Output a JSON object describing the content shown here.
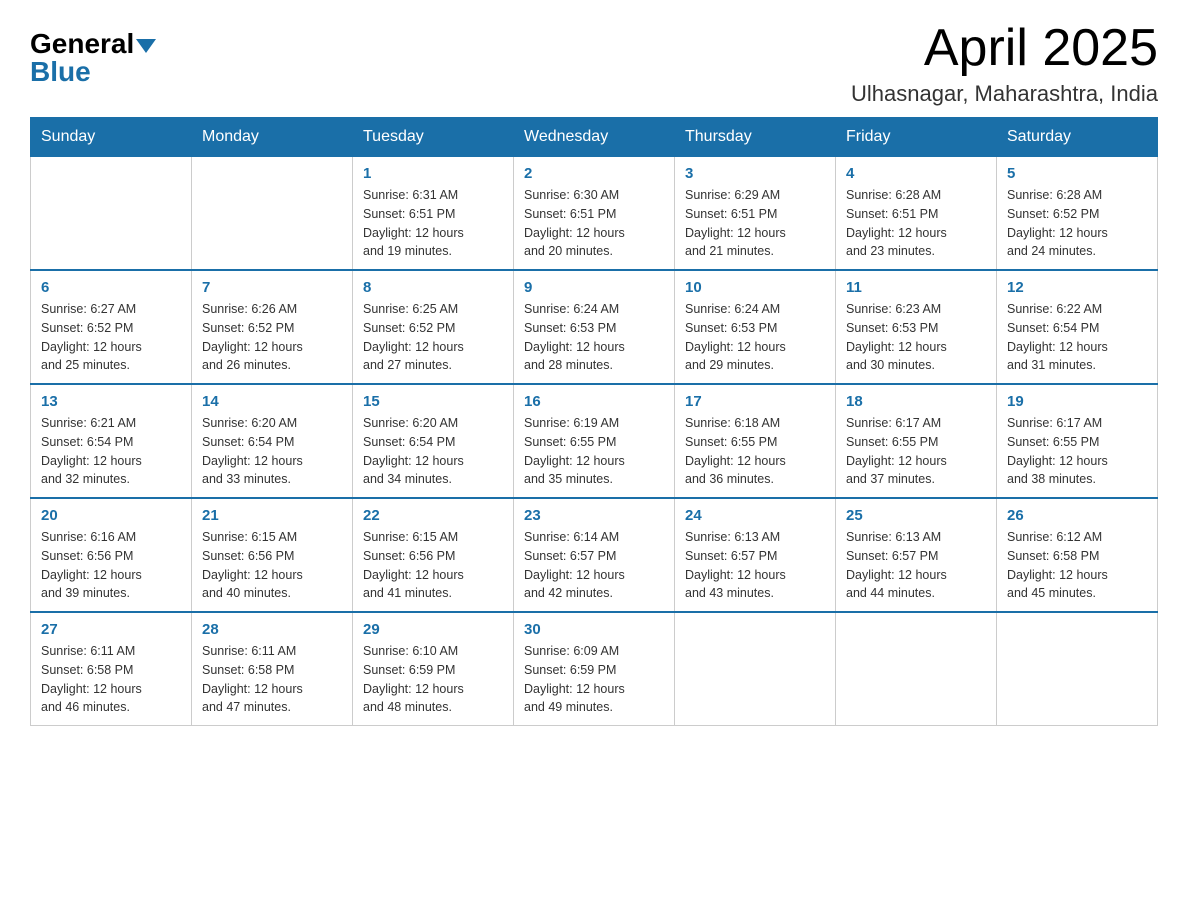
{
  "header": {
    "logo": {
      "general": "General",
      "blue": "Blue"
    },
    "title": "April 2025",
    "location": "Ulhasnagar, Maharashtra, India"
  },
  "weekdays": [
    "Sunday",
    "Monday",
    "Tuesday",
    "Wednesday",
    "Thursday",
    "Friday",
    "Saturday"
  ],
  "weeks": [
    [
      {
        "day": "",
        "info": ""
      },
      {
        "day": "",
        "info": ""
      },
      {
        "day": "1",
        "info": "Sunrise: 6:31 AM\nSunset: 6:51 PM\nDaylight: 12 hours\nand 19 minutes."
      },
      {
        "day": "2",
        "info": "Sunrise: 6:30 AM\nSunset: 6:51 PM\nDaylight: 12 hours\nand 20 minutes."
      },
      {
        "day": "3",
        "info": "Sunrise: 6:29 AM\nSunset: 6:51 PM\nDaylight: 12 hours\nand 21 minutes."
      },
      {
        "day": "4",
        "info": "Sunrise: 6:28 AM\nSunset: 6:51 PM\nDaylight: 12 hours\nand 23 minutes."
      },
      {
        "day": "5",
        "info": "Sunrise: 6:28 AM\nSunset: 6:52 PM\nDaylight: 12 hours\nand 24 minutes."
      }
    ],
    [
      {
        "day": "6",
        "info": "Sunrise: 6:27 AM\nSunset: 6:52 PM\nDaylight: 12 hours\nand 25 minutes."
      },
      {
        "day": "7",
        "info": "Sunrise: 6:26 AM\nSunset: 6:52 PM\nDaylight: 12 hours\nand 26 minutes."
      },
      {
        "day": "8",
        "info": "Sunrise: 6:25 AM\nSunset: 6:52 PM\nDaylight: 12 hours\nand 27 minutes."
      },
      {
        "day": "9",
        "info": "Sunrise: 6:24 AM\nSunset: 6:53 PM\nDaylight: 12 hours\nand 28 minutes."
      },
      {
        "day": "10",
        "info": "Sunrise: 6:24 AM\nSunset: 6:53 PM\nDaylight: 12 hours\nand 29 minutes."
      },
      {
        "day": "11",
        "info": "Sunrise: 6:23 AM\nSunset: 6:53 PM\nDaylight: 12 hours\nand 30 minutes."
      },
      {
        "day": "12",
        "info": "Sunrise: 6:22 AM\nSunset: 6:54 PM\nDaylight: 12 hours\nand 31 minutes."
      }
    ],
    [
      {
        "day": "13",
        "info": "Sunrise: 6:21 AM\nSunset: 6:54 PM\nDaylight: 12 hours\nand 32 minutes."
      },
      {
        "day": "14",
        "info": "Sunrise: 6:20 AM\nSunset: 6:54 PM\nDaylight: 12 hours\nand 33 minutes."
      },
      {
        "day": "15",
        "info": "Sunrise: 6:20 AM\nSunset: 6:54 PM\nDaylight: 12 hours\nand 34 minutes."
      },
      {
        "day": "16",
        "info": "Sunrise: 6:19 AM\nSunset: 6:55 PM\nDaylight: 12 hours\nand 35 minutes."
      },
      {
        "day": "17",
        "info": "Sunrise: 6:18 AM\nSunset: 6:55 PM\nDaylight: 12 hours\nand 36 minutes."
      },
      {
        "day": "18",
        "info": "Sunrise: 6:17 AM\nSunset: 6:55 PM\nDaylight: 12 hours\nand 37 minutes."
      },
      {
        "day": "19",
        "info": "Sunrise: 6:17 AM\nSunset: 6:55 PM\nDaylight: 12 hours\nand 38 minutes."
      }
    ],
    [
      {
        "day": "20",
        "info": "Sunrise: 6:16 AM\nSunset: 6:56 PM\nDaylight: 12 hours\nand 39 minutes."
      },
      {
        "day": "21",
        "info": "Sunrise: 6:15 AM\nSunset: 6:56 PM\nDaylight: 12 hours\nand 40 minutes."
      },
      {
        "day": "22",
        "info": "Sunrise: 6:15 AM\nSunset: 6:56 PM\nDaylight: 12 hours\nand 41 minutes."
      },
      {
        "day": "23",
        "info": "Sunrise: 6:14 AM\nSunset: 6:57 PM\nDaylight: 12 hours\nand 42 minutes."
      },
      {
        "day": "24",
        "info": "Sunrise: 6:13 AM\nSunset: 6:57 PM\nDaylight: 12 hours\nand 43 minutes."
      },
      {
        "day": "25",
        "info": "Sunrise: 6:13 AM\nSunset: 6:57 PM\nDaylight: 12 hours\nand 44 minutes."
      },
      {
        "day": "26",
        "info": "Sunrise: 6:12 AM\nSunset: 6:58 PM\nDaylight: 12 hours\nand 45 minutes."
      }
    ],
    [
      {
        "day": "27",
        "info": "Sunrise: 6:11 AM\nSunset: 6:58 PM\nDaylight: 12 hours\nand 46 minutes."
      },
      {
        "day": "28",
        "info": "Sunrise: 6:11 AM\nSunset: 6:58 PM\nDaylight: 12 hours\nand 47 minutes."
      },
      {
        "day": "29",
        "info": "Sunrise: 6:10 AM\nSunset: 6:59 PM\nDaylight: 12 hours\nand 48 minutes."
      },
      {
        "day": "30",
        "info": "Sunrise: 6:09 AM\nSunset: 6:59 PM\nDaylight: 12 hours\nand 49 minutes."
      },
      {
        "day": "",
        "info": ""
      },
      {
        "day": "",
        "info": ""
      },
      {
        "day": "",
        "info": ""
      }
    ]
  ]
}
